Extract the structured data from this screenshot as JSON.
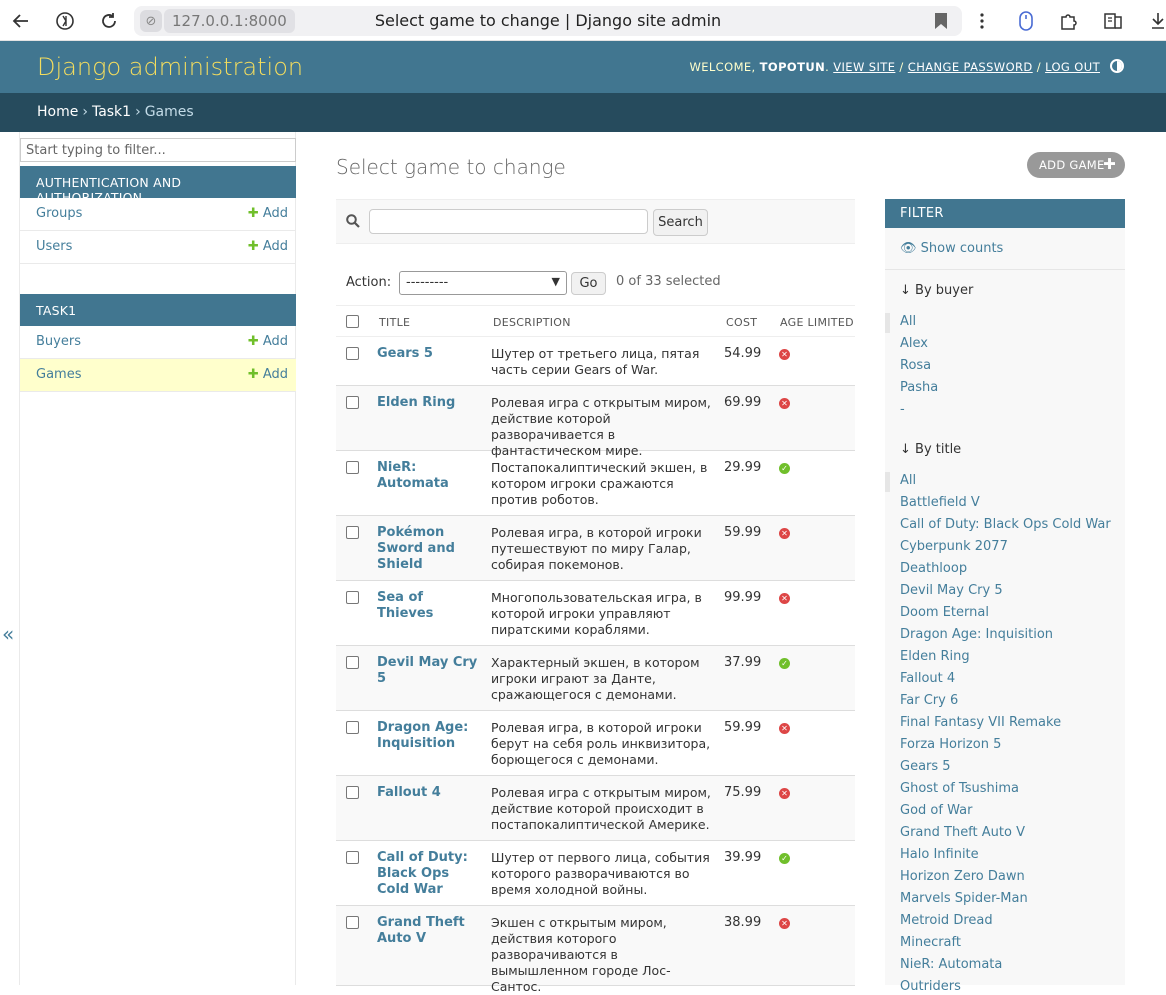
{
  "browser": {
    "url": "127.0.0.1:8000",
    "tab_title": "Select game to change | Django site admin"
  },
  "header": {
    "branding": "Django administration",
    "welcome": "WELCOME,",
    "username": "TOPOTUN",
    "view_site": "VIEW SITE",
    "change_password": "CHANGE PASSWORD",
    "log_out": "LOG OUT"
  },
  "breadcrumbs": {
    "home": "Home",
    "app": "Task1",
    "current": "Games"
  },
  "sidebar": {
    "filter_placeholder": "Start typing to filter...",
    "auth": {
      "caption": "AUTHENTICATION AND AUTHORIZATION",
      "models": [
        {
          "name": "Groups",
          "add": "Add"
        },
        {
          "name": "Users",
          "add": "Add"
        }
      ]
    },
    "task1": {
      "caption": "TASK1",
      "models": [
        {
          "name": "Buyers",
          "add": "Add"
        },
        {
          "name": "Games",
          "add": "Add"
        }
      ]
    },
    "toggle": "«"
  },
  "content": {
    "title": "Select game to change",
    "add_button": "ADD GAME",
    "search_button": "Search",
    "action_label": "Action:",
    "action_value": "---------",
    "go_button": "Go",
    "selected_count": "0 of 33 selected",
    "columns": {
      "title": "TITLE",
      "description": "DESCRIPTION",
      "cost": "COST",
      "age_limited": "AGE LIMITED"
    },
    "rows": [
      {
        "title": "Gears 5",
        "description": "Шутер от третьего лица, пятая часть серии Gears of War.",
        "cost": "54.99",
        "age_limited": false
      },
      {
        "title": "Elden Ring",
        "description": "Ролевая игра с открытым миром, действие которой разворачивается в фантастическом мире.",
        "cost": "69.99",
        "age_limited": false
      },
      {
        "title": "NieR: Automata",
        "description": "Постапокалиптический экшен, в котором игроки сражаются против роботов.",
        "cost": "29.99",
        "age_limited": true
      },
      {
        "title": "Pokémon Sword and Shield",
        "description": "Ролевая игра, в которой игроки путешествуют по миру Галар, собирая покемонов.",
        "cost": "59.99",
        "age_limited": false
      },
      {
        "title": "Sea of Thieves",
        "description": "Многопользовательская игра, в которой игроки управляют пиратскими кораблями.",
        "cost": "99.99",
        "age_limited": false
      },
      {
        "title": "Devil May Cry 5",
        "description": "Характерный экшен, в котором игроки играют за Данте, сражающегося с демонами.",
        "cost": "37.99",
        "age_limited": true
      },
      {
        "title": "Dragon Age: Inquisition",
        "description": "Ролевая игра, в которой игроки берут на себя роль инквизитора, борющегося с демонами.",
        "cost": "59.99",
        "age_limited": false
      },
      {
        "title": "Fallout 4",
        "description": "Ролевая игра с открытым миром, действие которой происходит в постапокалиптической Америке.",
        "cost": "75.99",
        "age_limited": false
      },
      {
        "title": "Call of Duty: Black Ops Cold War",
        "description": "Шутер от первого лица, события которого разворачиваются во время холодной войны.",
        "cost": "39.99",
        "age_limited": true
      },
      {
        "title": "Grand Theft Auto V",
        "description": "Экшен с открытым миром, действия которого разворачиваются в вымышленном городе Лос-Сантос.",
        "cost": "38.99",
        "age_limited": false
      }
    ]
  },
  "filter": {
    "heading": "FILTER",
    "show_counts": "Show counts",
    "by_buyer": {
      "title": "↓ By buyer",
      "items": [
        "All",
        "Alex",
        "Rosa",
        "Pasha",
        "-"
      ]
    },
    "by_title": {
      "title": "↓ By title",
      "items": [
        "All",
        "Battlefield V",
        "Call of Duty: Black Ops Cold War",
        "Cyberpunk 2077",
        "Deathloop",
        "Devil May Cry 5",
        "Doom Eternal",
        "Dragon Age: Inquisition",
        "Elden Ring",
        "Fallout 4",
        "Far Cry 6",
        "Final Fantasy VII Remake",
        "Forza Horizon 5",
        "Gears 5",
        "Ghost of Tsushima",
        "God of War",
        "Grand Theft Auto V",
        "Halo Infinite",
        "Horizon Zero Dawn",
        "Marvels Spider-Man",
        "Metroid Dread",
        "Minecraft",
        "NieR: Automata",
        "Outriders"
      ]
    }
  }
}
